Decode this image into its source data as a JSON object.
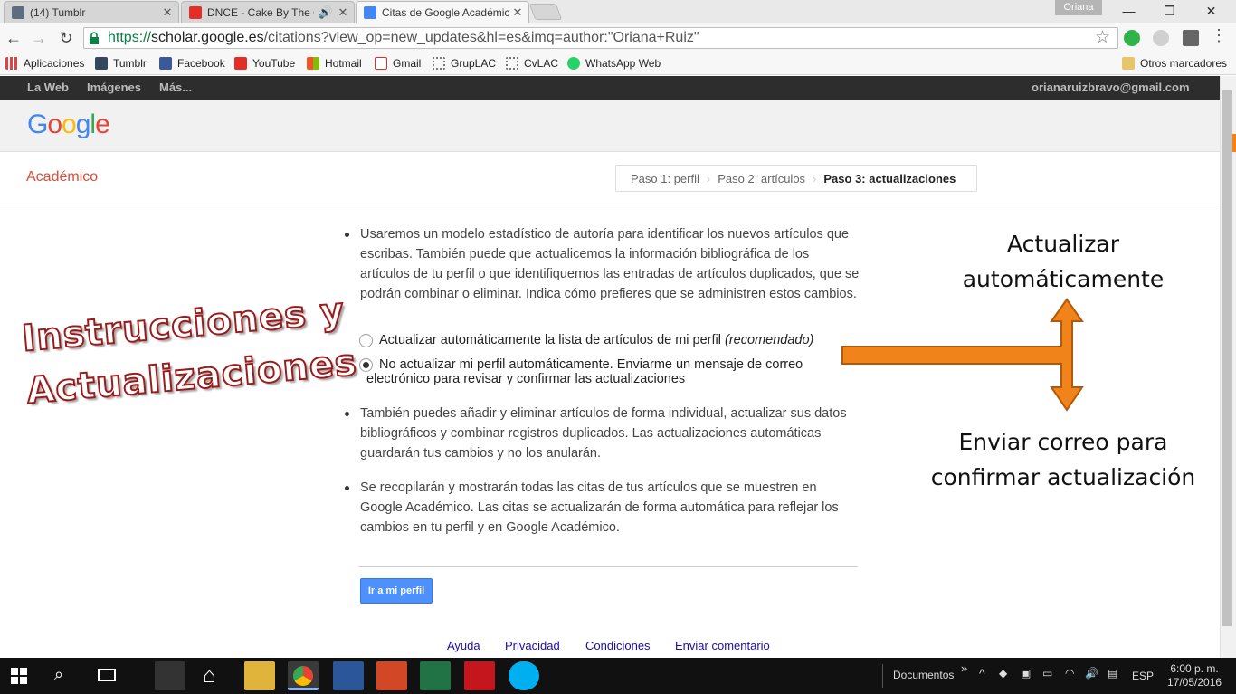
{
  "browser": {
    "tabs": [
      {
        "title": "(14) Tumblr",
        "icon": "tumblr-icon"
      },
      {
        "title": "DNCE - Cake By The Oc",
        "icon": "youtube-icon"
      },
      {
        "title": "Citas de Google Académic",
        "icon": "scholar-icon"
      }
    ],
    "profile_name": "Oriana",
    "url_scheme": "https://",
    "url_host": "scholar.google.es",
    "url_path": "/citations?view_op=new_updates&hl=es&imq=author:\"Oriana+Ruiz\"",
    "bookmarks": [
      {
        "label": "Aplicaciones",
        "icon": "apps-icon",
        "color": "#d44"
      },
      {
        "label": "Tumblr",
        "icon": "tumblr-icon",
        "color": "#36465d"
      },
      {
        "label": "Facebook",
        "icon": "facebook-icon",
        "color": "#3b5998"
      },
      {
        "label": "YouTube",
        "icon": "youtube-icon",
        "color": "#e52d27"
      },
      {
        "label": "Hotmail",
        "icon": "hotmail-icon",
        "color": "#f35325"
      },
      {
        "label": "Gmail",
        "icon": "gmail-icon",
        "color": "#d93025"
      },
      {
        "label": "GrupLAC",
        "icon": "gruplac-icon",
        "color": "#777"
      },
      {
        "label": "CvLAC",
        "icon": "cvlac-icon",
        "color": "#777"
      },
      {
        "label": "WhatsApp Web",
        "icon": "whatsapp-icon",
        "color": "#25d366"
      }
    ],
    "other_bookmarks": "Otros marcadores"
  },
  "google_bar": {
    "links": [
      "La Web",
      "Imágenes",
      "Más..."
    ],
    "user_email": "orianaruizbravo@gmail.com"
  },
  "scholar": {
    "section": "Académico",
    "steps": [
      "Paso 1: perfil",
      "Paso 2: artículos",
      "Paso 3: actualizaciones"
    ],
    "paragraph1": "Usaremos un modelo estadístico de autoría para identificar los nuevos artículos que escribas. También puede que actualicemos la información bibliográfica de los artículos de tu perfil o que identifiquemos las entradas de artículos duplicados, que se podrán combinar o eliminar. Indica cómo prefieres que se administren estos cambios.",
    "option_auto": "Actualizar automáticamente la lista de artículos de mi perfil",
    "option_auto_note": "(recomendado)",
    "option_manual_line1": "No actualizar mi perfil automáticamente. Enviarme un mensaje de correo",
    "option_manual_line2": "electrónico para revisar y confirmar las actualizaciones",
    "selected_option": "manual",
    "paragraph2": "También puedes añadir y eliminar artículos de forma individual, actualizar sus datos bibliográficos y combinar registros duplicados. Las actualizaciones automáticas guardarán tus cambios y no los anularán.",
    "paragraph3": "Se recopilarán y mostrarán todas las citas de tus artículos que se muestren en Google Académico. Las citas se actualizarán de forma automática para reflejar los cambios en tu perfil y en Google Académico.",
    "button": "Ir a mi perfil",
    "footer": [
      "Ayuda",
      "Privacidad",
      "Condiciones",
      "Enviar comentario"
    ]
  },
  "annotations": {
    "title_line1": "Instrucciones y",
    "title_line2": "Actualizaciones",
    "auto_line1": "Actualizar",
    "auto_line2": "automáticamente",
    "mail_line1": "Enviar correo para",
    "mail_line2": "confirmar actualización",
    "arrow_color": "#f0831a"
  },
  "taskbar": {
    "folder_label": "Documentos",
    "language": "ESP",
    "time": "6:00 p. m.",
    "date": "17/05/2016"
  }
}
